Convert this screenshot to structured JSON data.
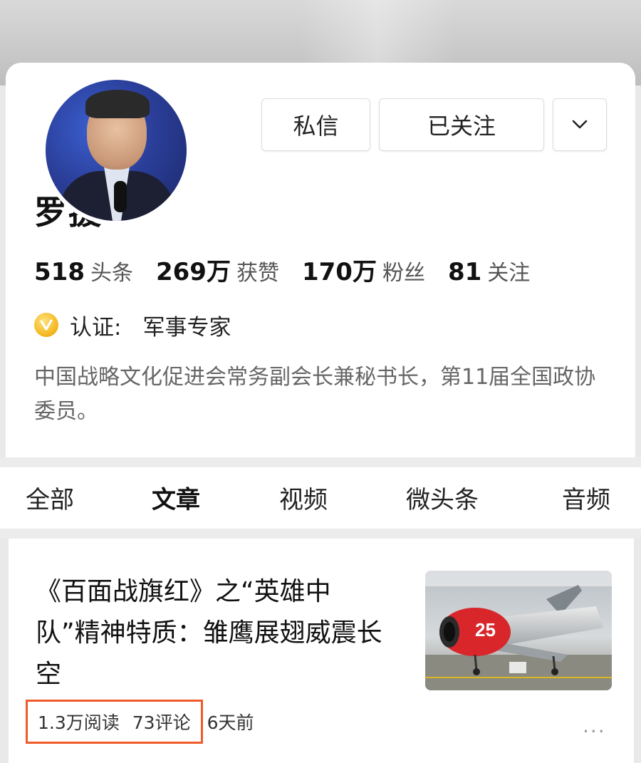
{
  "profile": {
    "name": "罗援",
    "buttons": {
      "message": "私信",
      "following": "已关注"
    },
    "stats": [
      {
        "value": "518",
        "label": "头条"
      },
      {
        "value": "269万",
        "label": "获赞"
      },
      {
        "value": "170万",
        "label": "粉丝"
      },
      {
        "value": "81",
        "label": "关注"
      }
    ],
    "verification": {
      "label": "认证:",
      "value": "军事专家"
    },
    "bio": "中国战略文化促进会常务副会长兼秘书长，第11届全国政协委员。"
  },
  "tabs": [
    {
      "label": "全部",
      "active": false
    },
    {
      "label": "文章",
      "active": true
    },
    {
      "label": "视频",
      "active": false
    },
    {
      "label": "微头条",
      "active": false
    },
    {
      "label": "音频",
      "active": false
    }
  ],
  "article": {
    "title": "《百面战旗红》之“英雄中队”精神特质：雏鹰展翅威震长空",
    "thumbnail_number": "25",
    "reads": "1.3万阅读",
    "comments": "73评论",
    "time": "6天前",
    "more": "···"
  },
  "colors": {
    "highlight_border": "#f05a28",
    "badge": "#f3b41a"
  }
}
